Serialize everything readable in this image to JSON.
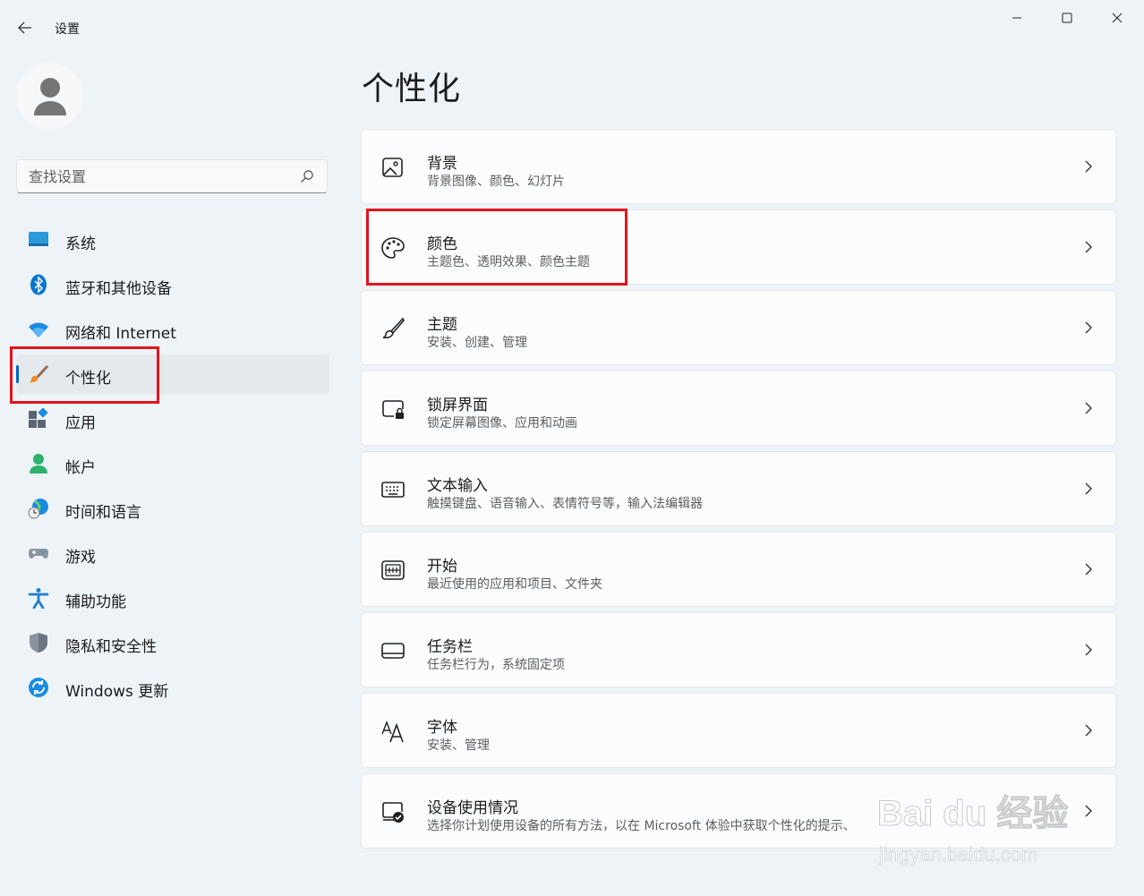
{
  "window": {
    "title": "设置"
  },
  "search": {
    "placeholder": "查找设置"
  },
  "sidebar": {
    "items": [
      {
        "label": "系统",
        "icon": "monitor-icon"
      },
      {
        "label": "蓝牙和其他设备",
        "icon": "bluetooth-icon"
      },
      {
        "label": "网络和 Internet",
        "icon": "wifi-icon"
      },
      {
        "label": "个性化",
        "icon": "paintbrush-icon",
        "active": true
      },
      {
        "label": "应用",
        "icon": "apps-icon"
      },
      {
        "label": "帐户",
        "icon": "account-icon"
      },
      {
        "label": "时间和语言",
        "icon": "globe-clock-icon"
      },
      {
        "label": "游戏",
        "icon": "gamepad-icon"
      },
      {
        "label": "辅助功能",
        "icon": "accessibility-icon"
      },
      {
        "label": "隐私和安全性",
        "icon": "shield-icon"
      },
      {
        "label": "Windows 更新",
        "icon": "update-icon"
      }
    ]
  },
  "main": {
    "title": "个性化",
    "cards": [
      {
        "title": "背景",
        "subtitle": "背景图像、颜色、幻灯片",
        "icon": "image-icon"
      },
      {
        "title": "颜色",
        "subtitle": "主题色、透明效果、颜色主题",
        "icon": "palette-icon"
      },
      {
        "title": "主题",
        "subtitle": "安装、创建、管理",
        "icon": "brush-icon"
      },
      {
        "title": "锁屏界面",
        "subtitle": "锁定屏幕图像、应用和动画",
        "icon": "lock-screen-icon"
      },
      {
        "title": "文本输入",
        "subtitle": "触摸键盘、语音输入、表情符号等，输入法编辑器",
        "icon": "keyboard-icon"
      },
      {
        "title": "开始",
        "subtitle": "最近使用的应用和项目、文件夹",
        "icon": "start-icon"
      },
      {
        "title": "任务栏",
        "subtitle": "任务栏行为，系统固定项",
        "icon": "taskbar-icon"
      },
      {
        "title": "字体",
        "subtitle": "安装、管理",
        "icon": "font-icon"
      },
      {
        "title": "设备使用情况",
        "subtitle": "选择你计划使用设备的所有方法，以在 Microsoft 体验中获取个性化的提示、",
        "icon": "device-usage-icon"
      }
    ]
  },
  "watermark": {
    "main": "Bai du 经验",
    "sub": "jingyan.baidu.com"
  },
  "colors": {
    "background": "#eef3f8",
    "accent": "#0067c0",
    "highlight": "#e3141b"
  }
}
